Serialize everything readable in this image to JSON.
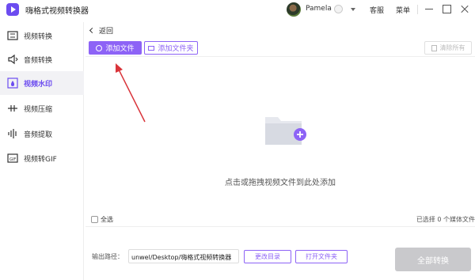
{
  "titlebar": {
    "app_title": "嗨格式视频转换器",
    "user_name": "Pamela",
    "service_label": "客服",
    "menu_label": "菜单"
  },
  "sidebar": {
    "items": [
      {
        "label": "视频转换",
        "icon": "video-convert-icon",
        "active": false
      },
      {
        "label": "音频转换",
        "icon": "audio-convert-icon",
        "active": false
      },
      {
        "label": "视频水印",
        "icon": "watermark-icon",
        "active": true
      },
      {
        "label": "视频压缩",
        "icon": "compress-icon",
        "active": false
      },
      {
        "label": "音频提取",
        "icon": "audio-extract-icon",
        "active": false
      },
      {
        "label": "视频转GIF",
        "icon": "gif-icon",
        "active": false
      }
    ]
  },
  "main": {
    "back_label": "返回",
    "add_file_label": "添加文件",
    "add_folder_label": "添加文件夹",
    "clear_all_label": "清除所有",
    "drop_hint": "点击或拖拽视频文件到此处添加",
    "select_all_label": "全选",
    "selected_count_text": "已选择 0 个媒体文件",
    "output_label": "输出路径：",
    "output_path": "unwel/Desktop/嗨格式视频转换器",
    "change_dir_label": "更改目录",
    "open_folder_label": "打开文件夹",
    "convert_all_label": "全部转换"
  },
  "colors": {
    "accent": "#8d63f6",
    "annotation_arrow": "#d9343a",
    "disabled_button": "#c9c9cc"
  }
}
